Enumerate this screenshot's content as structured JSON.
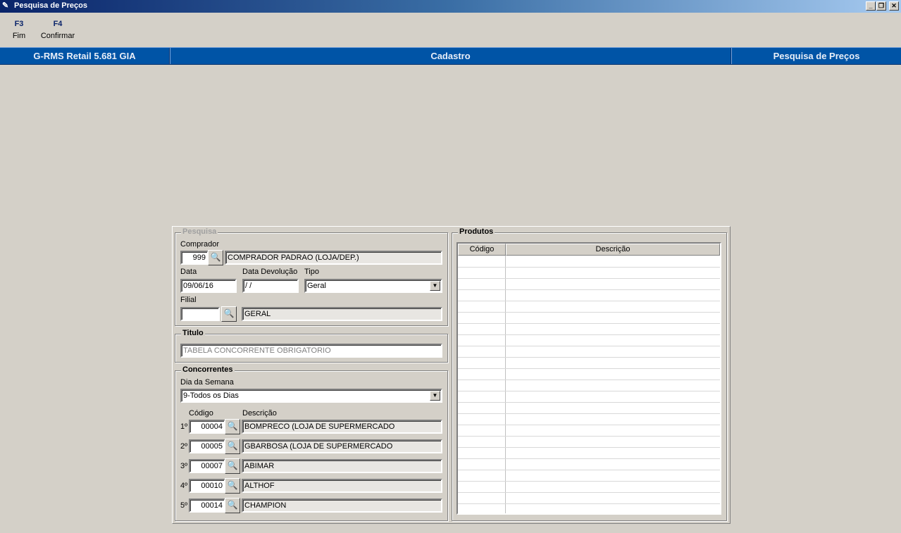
{
  "window": {
    "title": "Pesquisa de Preços",
    "controls": [
      "minimize",
      "restore",
      "close"
    ]
  },
  "toolbar": {
    "f3_key": "F3",
    "f3_label": "Fim",
    "f4_key": "F4",
    "f4_label": "Confirmar"
  },
  "header": {
    "app": "G-RMS Retail 5.681 GIA",
    "module": "Cadastro",
    "screen": "Pesquisa de Preços"
  },
  "pesquisa": {
    "legend": "Pesquisa",
    "comprador_label": "Comprador",
    "comprador_code": "999",
    "comprador_name": "COMPRADOR PADRAO (LOJA/DEP.)",
    "data_label": "Data",
    "data_value": "09/06/16",
    "devolucao_label": "Data Devolução",
    "devolucao_value": " /  /",
    "tipo_label": "Tipo",
    "tipo_value": "Geral",
    "filial_label": "Filial",
    "filial_code": "",
    "filial_name": "GERAL"
  },
  "titulo": {
    "legend": "Titulo",
    "value": "TABELA CONCORRENTE OBRIGATORIO"
  },
  "concorrentes": {
    "legend": "Concorrentes",
    "dia_label": "Dia da Semana",
    "dia_value": "9-Todos os Dias",
    "col_codigo": "Código",
    "col_descricao": "Descrição",
    "rows": [
      {
        "ord": "1º",
        "code": "00004",
        "desc": "BOMPRECO (LOJA DE SUPERMERCADO"
      },
      {
        "ord": "2º",
        "code": "00005",
        "desc": "GBARBOSA (LOJA DE SUPERMERCADO"
      },
      {
        "ord": "3º",
        "code": "00007",
        "desc": "ABIMAR"
      },
      {
        "ord": "4º",
        "code": "00010",
        "desc": "ALTHOF"
      },
      {
        "ord": "5º",
        "code": "00014",
        "desc": "CHAMPION"
      }
    ]
  },
  "produtos": {
    "legend": "Produtos",
    "col_codigo": "Código",
    "col_descricao": "Descrição"
  },
  "icons": {
    "search": "binoculars-icon",
    "dropdown": "chevron-down-icon"
  }
}
